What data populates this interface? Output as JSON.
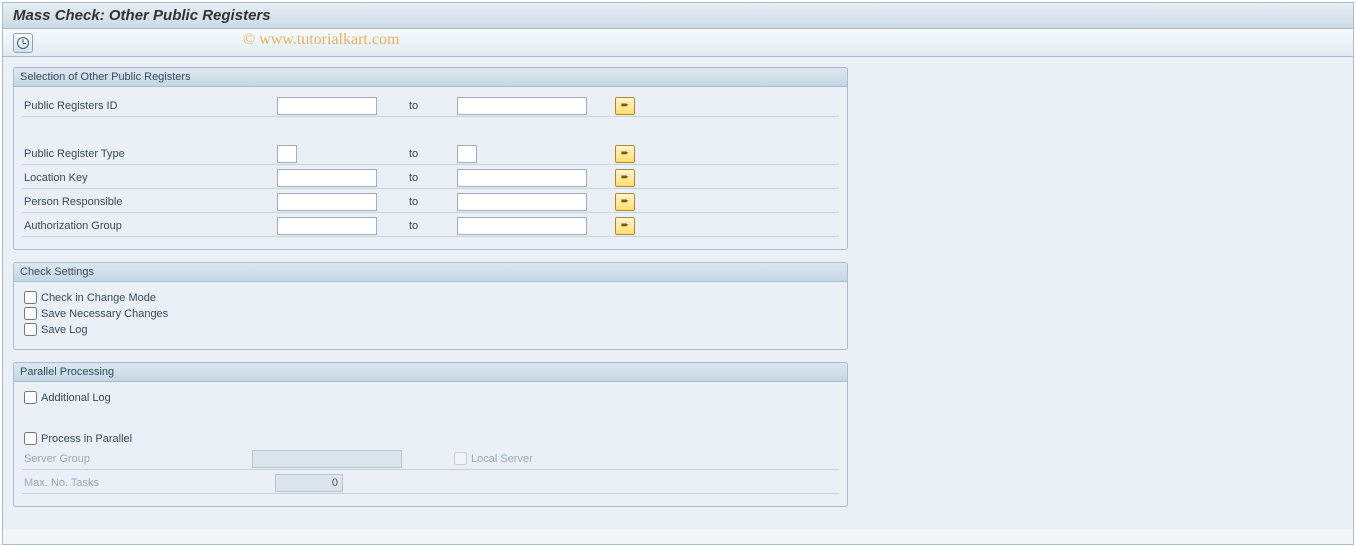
{
  "title": "Mass Check: Other Public Registers",
  "watermark": "© www.tutorialkart.com",
  "groups": {
    "selection": {
      "title": "Selection of Other Public Registers",
      "rows": {
        "public_registers_id": {
          "label": "Public Registers ID",
          "from": "",
          "to_label": "to",
          "to": ""
        },
        "public_register_type": {
          "label": "Public Register Type",
          "from": "",
          "to_label": "to",
          "to": ""
        },
        "location_key": {
          "label": "Location Key",
          "from": "",
          "to_label": "to",
          "to": ""
        },
        "person_responsible": {
          "label": "Person Responsible",
          "from": "",
          "to_label": "to",
          "to": ""
        },
        "authorization_group": {
          "label": "Authorization Group",
          "from": "",
          "to_label": "to",
          "to": ""
        }
      }
    },
    "check_settings": {
      "title": "Check Settings",
      "checks": {
        "change_mode": {
          "label": "Check in Change Mode",
          "checked": false
        },
        "save_changes": {
          "label": "Save Necessary Changes",
          "checked": false
        },
        "save_log": {
          "label": "Save Log",
          "checked": false
        }
      }
    },
    "parallel": {
      "title": "Parallel Processing",
      "checks": {
        "additional_log": {
          "label": "Additional Log",
          "checked": false
        },
        "process_parallel": {
          "label": "Process in Parallel",
          "checked": false
        },
        "local_server": {
          "label": "Local Server",
          "checked": false
        }
      },
      "fields": {
        "server_group": {
          "label": "Server Group",
          "value": ""
        },
        "max_tasks": {
          "label": "Max. No. Tasks",
          "value": "0"
        }
      }
    }
  }
}
